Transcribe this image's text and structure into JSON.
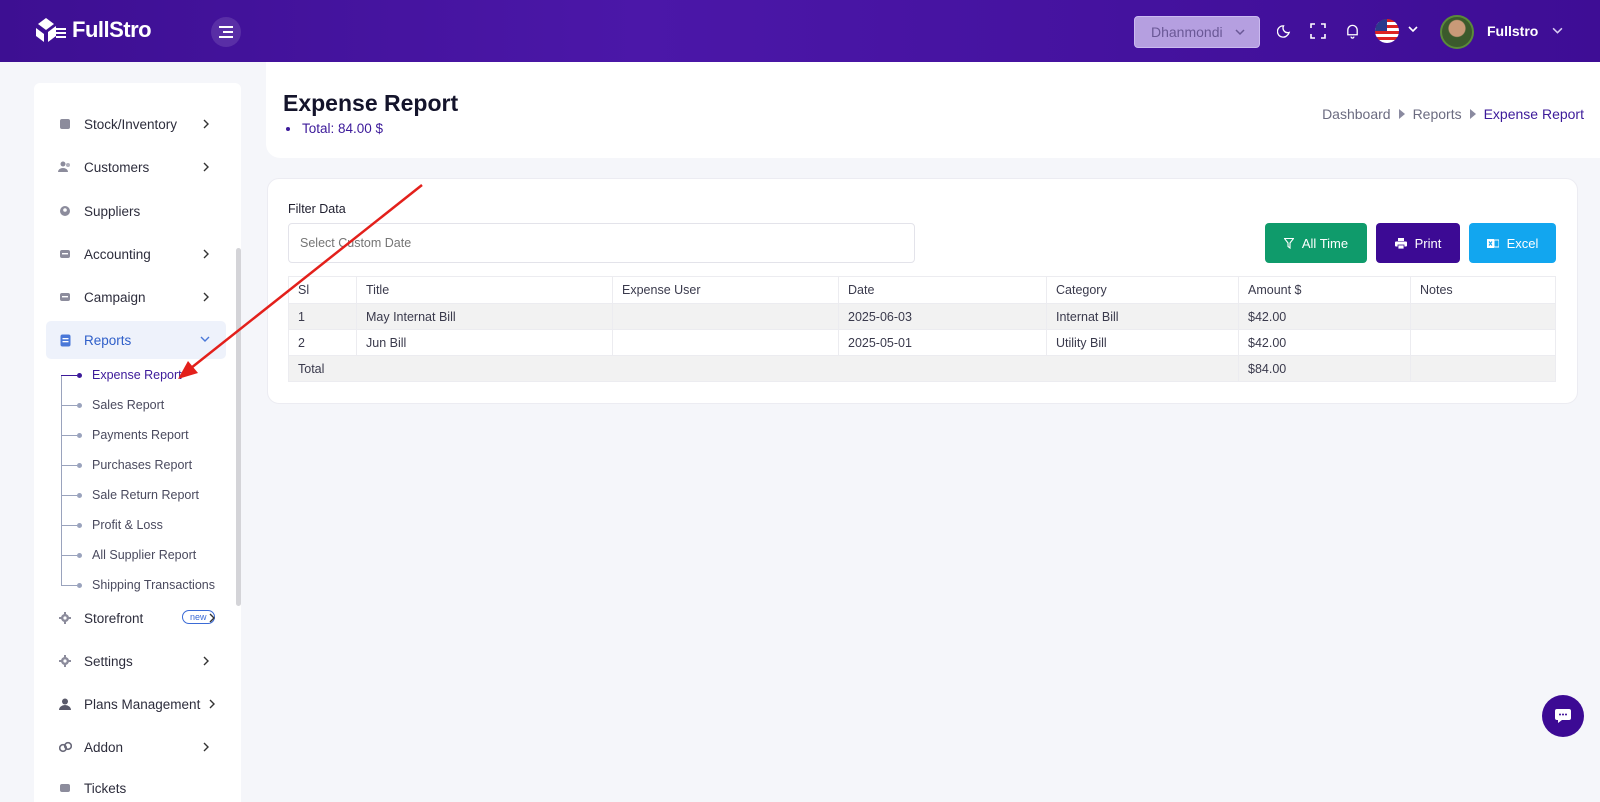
{
  "header": {
    "logo_text": "FullStro",
    "branch_select": "Dhanmondi",
    "user_name": "Fullstro",
    "icons": [
      "menu-icon",
      "moon-icon",
      "fullscreen-icon",
      "bell-icon",
      "us-flag-icon",
      "avatar"
    ]
  },
  "sidebar": {
    "items": [
      {
        "label": "Stock/Inventory",
        "icon": "box-icon"
      },
      {
        "label": "Customers",
        "icon": "users-icon"
      },
      {
        "label": "Suppliers",
        "icon": "supplier-icon"
      },
      {
        "label": "Accounting",
        "icon": "wallet-icon"
      },
      {
        "label": "Campaign",
        "icon": "megaphone-icon"
      },
      {
        "label": "Reports",
        "icon": "report-icon"
      },
      {
        "label": "Storefront",
        "icon": "store-icon",
        "badge": "new"
      },
      {
        "label": "Settings",
        "icon": "gear-icon"
      },
      {
        "label": "Plans Management",
        "icon": "user-plan-icon"
      },
      {
        "label": "Addon",
        "icon": "link-icon"
      },
      {
        "label": "Tickets",
        "icon": "ticket-icon"
      }
    ],
    "reports_sub": [
      "Expense Report",
      "Sales Report",
      "Payments Report",
      "Purchases Report",
      "Sale Return Report",
      "Profit & Loss",
      "All Supplier Report",
      "Shipping Transactions"
    ]
  },
  "page": {
    "title": "Expense Report",
    "total": "Total: 84.00 $",
    "breadcrumb": [
      "Dashboard",
      "Reports",
      "Expense Report"
    ]
  },
  "filter": {
    "label": "Filter Data",
    "date_placeholder": "Select Custom Date",
    "btn_all_time": "All Time",
    "btn_print": "Print",
    "btn_excel": "Excel"
  },
  "table": {
    "headers": [
      "Sl",
      "Title",
      "Expense User",
      "Date",
      "Category",
      "Amount $",
      "Notes"
    ],
    "rows": [
      {
        "sl": "1",
        "title": "May Internat Bill",
        "user": "",
        "date": "2025-06-03",
        "category": "Internat Bill",
        "amount": "$42.00",
        "notes": ""
      },
      {
        "sl": "2",
        "title": "Jun Bill",
        "user": "",
        "date": "2025-05-01",
        "category": "Utility Bill",
        "amount": "$42.00",
        "notes": ""
      }
    ],
    "total_label": "Total",
    "total_amount": "$84.00"
  },
  "colors": {
    "header_bg": "#4b17a8",
    "primary": "#3c0a94",
    "success": "#0f9b6b",
    "info": "#12a6ef",
    "annotation_arrow": "#e3201b"
  }
}
